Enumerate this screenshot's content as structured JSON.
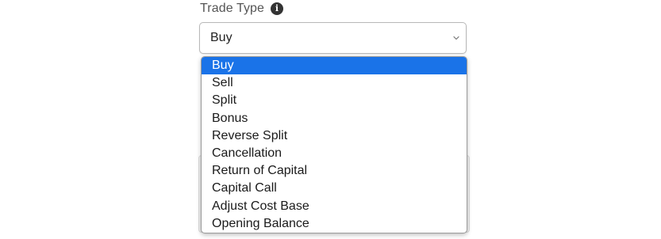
{
  "form": {
    "label": "Trade Type",
    "info_icon": "info-circle-icon",
    "chevron_icon": "chevron-down-icon"
  },
  "select": {
    "value": "Buy"
  },
  "options": [
    "Buy",
    "Sell",
    "Split",
    "Bonus",
    "Reverse Split",
    "Cancellation",
    "Return of Capital",
    "Capital Call",
    "Adjust Cost Base",
    "Opening Balance"
  ],
  "colors": {
    "selected_bg": "#1a73e8",
    "selected_text": "#ffffff"
  }
}
